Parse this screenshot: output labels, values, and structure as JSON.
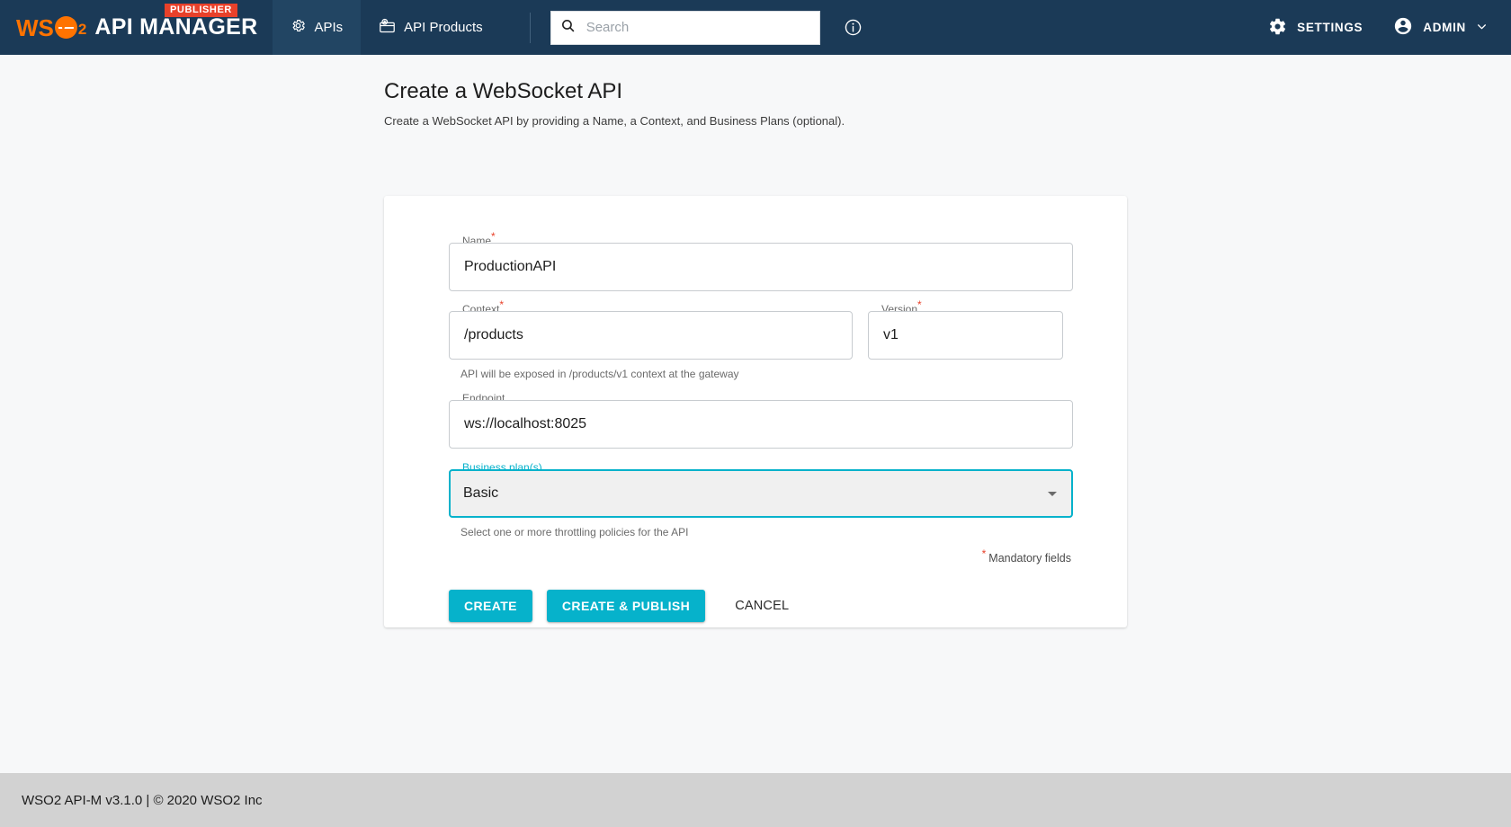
{
  "topbar": {
    "brand": {
      "wso": "WS",
      "o_sub": "2",
      "title": "API MANAGER",
      "badge": "PUBLISHER"
    },
    "nav": [
      {
        "label": "APIs",
        "icon": "gear-api-icon",
        "active": true
      },
      {
        "label": "API Products",
        "icon": "api-products-icon",
        "active": false
      }
    ],
    "search": {
      "placeholder": "Search",
      "value": ""
    },
    "info_icon": "info-icon",
    "settings": {
      "label": "SETTINGS",
      "icon": "gear-icon"
    },
    "admin": {
      "label": "ADMIN",
      "icon": "account-circle-icon",
      "chevron": "chevron-down-icon"
    }
  },
  "page": {
    "title": "Create a WebSocket API",
    "subtitle": "Create a WebSocket API by providing a Name, a Context, and Business Plans (optional)."
  },
  "form": {
    "name": {
      "label": "Name",
      "value": "ProductionAPI",
      "required": true
    },
    "context": {
      "label": "Context",
      "value": "/products",
      "required": true,
      "helper": "API will be exposed in /products/v1 context at the gateway"
    },
    "version": {
      "label": "Version",
      "value": "v1",
      "required": true
    },
    "endpoint": {
      "label": "Endpoint",
      "value": "ws://localhost:8025",
      "required": false
    },
    "business_plans": {
      "label": "Business plan(s)",
      "value": "Basic",
      "helper": "Select one or more throttling policies for the API",
      "focused": true
    },
    "mandatory_note": "Mandatory fields",
    "buttons": {
      "create": "CREATE",
      "create_publish": "CREATE & PUBLISH",
      "cancel": "CANCEL"
    }
  },
  "footer": {
    "text": "WSO2 API-M v3.1.0 | © 2020 WSO2 Inc"
  },
  "colors": {
    "navy": "#1b3a57",
    "teal": "#06b2cb",
    "orange": "#ff7300",
    "badge_red": "#e8412a",
    "page_bg": "#f7f8f9",
    "footer_bg": "#d2d2d2"
  }
}
